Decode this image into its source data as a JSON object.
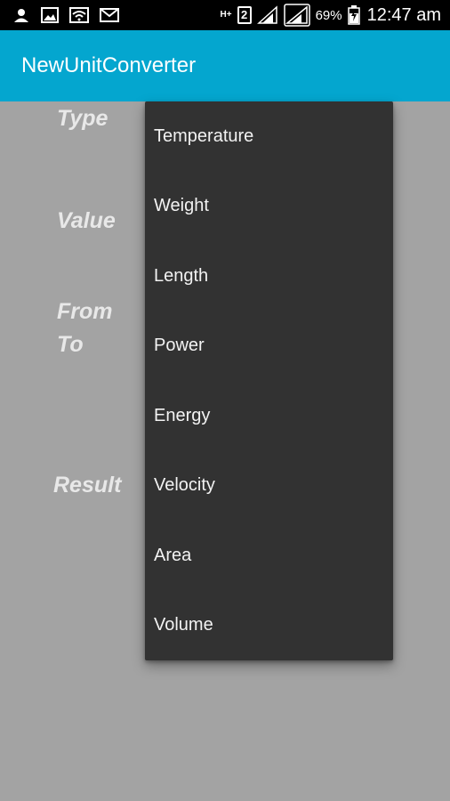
{
  "status_bar": {
    "left_icons": [
      "person-notification-icon",
      "image-notification-icon",
      "wifi-notification-icon",
      "mail-notification-icon"
    ],
    "network_type": "H+",
    "sim_slot": "2",
    "battery_percent": "69%",
    "time": "12:47 am"
  },
  "app_bar": {
    "title": "NewUnitConverter",
    "color": "#04a6cf"
  },
  "form": {
    "type_label": "Type",
    "value_label": "Value",
    "from_label": "From",
    "to_label": "To",
    "result_label": "Result"
  },
  "dropdown": {
    "items": [
      {
        "label": "Temperature"
      },
      {
        "label": "Weight"
      },
      {
        "label": "Length"
      },
      {
        "label": "Power"
      },
      {
        "label": "Energy"
      },
      {
        "label": "Velocity"
      },
      {
        "label": "Area"
      },
      {
        "label": "Volume"
      }
    ]
  }
}
